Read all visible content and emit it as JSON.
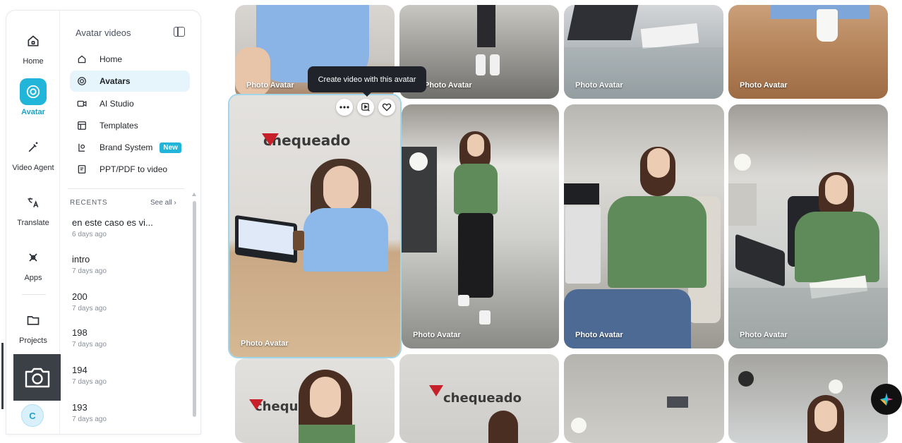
{
  "rail": {
    "items": [
      {
        "label": "Home",
        "icon": "home-icon"
      },
      {
        "label": "Avatar",
        "icon": "avatar-icon"
      },
      {
        "label": "Video Agent",
        "icon": "magic-wand-icon"
      },
      {
        "label": "Translate",
        "icon": "translate-icon"
      },
      {
        "label": "Apps",
        "icon": "apps-icon"
      },
      {
        "label": "Projects",
        "icon": "folder-icon"
      }
    ],
    "user_initial": "C"
  },
  "panel": {
    "title": "Avatar videos",
    "nav": [
      {
        "label": "Home",
        "icon": "home-icon"
      },
      {
        "label": "Avatars",
        "icon": "avatar-icon"
      },
      {
        "label": "AI Studio",
        "icon": "video-camera-icon"
      },
      {
        "label": "Templates",
        "icon": "templates-icon"
      },
      {
        "label": "Brand System",
        "icon": "brand-icon",
        "badge": "New"
      },
      {
        "label": "PPT/PDF to video",
        "icon": "slides-icon"
      }
    ],
    "recents_label": "RECENTS",
    "see_all": "See all ›",
    "recents": [
      {
        "title": "en este caso es vi...",
        "date": "6 days ago"
      },
      {
        "title": "intro",
        "date": "7 days ago"
      },
      {
        "title": "200",
        "date": "7 days ago"
      },
      {
        "title": "198",
        "date": "7 days ago"
      },
      {
        "title": "194",
        "date": "7 days ago"
      },
      {
        "title": "193",
        "date": "7 days ago"
      }
    ]
  },
  "gallery": {
    "tooltip": "Create video with this avatar",
    "card_caption": "Photo Avatar",
    "brand_text": "chequeado",
    "colors": {
      "accent": "#21b6d9",
      "selected_border": "#9fd6ea"
    }
  }
}
